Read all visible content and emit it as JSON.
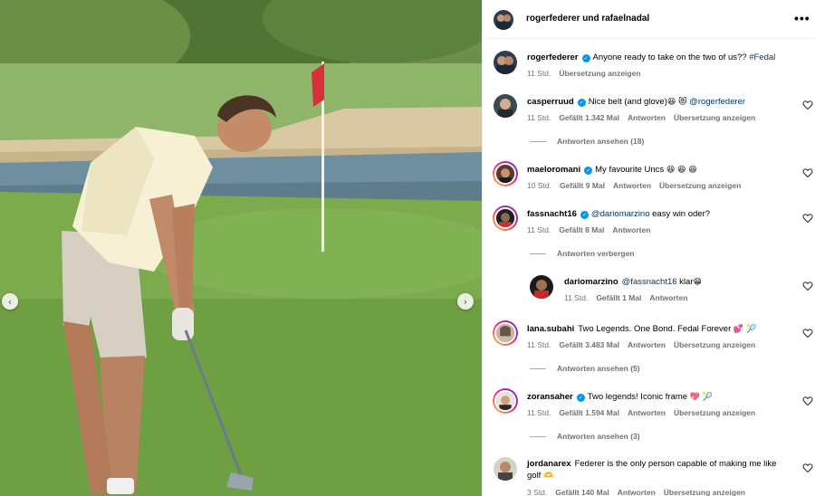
{
  "header": {
    "title": "rogerfederer und rafaelnadal",
    "more_icon": "more-horizontal-icon"
  },
  "photo": {
    "prev_icon": "‹",
    "next_icon": "›"
  },
  "caption": {
    "username": "rogerfederer",
    "text": "Anyone ready to take on the two of us??",
    "hashtag": "#Fedal",
    "time": "11 Std.",
    "translate": "Übersetzung anzeigen"
  },
  "comments": [
    {
      "username": "casperruud",
      "text": "Nice belt (and glove)",
      "emoji": "😆 😻",
      "mention": "@rogerfederer",
      "time": "11 Std.",
      "likes": "Gefällt 1.342 Mal",
      "reply": "Antworten",
      "translate": "Übersetzung anzeigen",
      "replies": "Antworten ansehen (18)"
    },
    {
      "username": "maeloromani",
      "text": "My favourite Uncs",
      "emoji": "😆 😆 😆",
      "time": "10 Std.",
      "likes": "Gefällt 9 Mal",
      "reply": "Antworten",
      "translate": "Übersetzung anzeigen"
    },
    {
      "username": "fassnacht16",
      "mention": "@dariomarzino",
      "text": "easy win oder?",
      "time": "11 Std.",
      "likes": "Gefällt 8 Mal",
      "reply": "Antworten",
      "replies": "Antworten verbergen"
    },
    {
      "username": "dariomarzino",
      "mention": "@fassnacht16",
      "text": "klar",
      "emoji": "😁",
      "time": "11 Std.",
      "likes": "Gefällt 1 Mal",
      "reply": "Antworten"
    },
    {
      "username": "lana.subahi",
      "text": "Two Legends. One Bond. Fedal Forever",
      "emoji": "💕 🎾",
      "time": "11 Std.",
      "likes": "Gefällt 3.483 Mal",
      "reply": "Antworten",
      "translate": "Übersetzung anzeigen",
      "replies": "Antworten ansehen (5)"
    },
    {
      "username": "zoransaher",
      "text": "Two legends! Iconic frame",
      "emoji": "💖 🎾",
      "time": "11 Std.",
      "likes": "Gefällt 1.594 Mal",
      "reply": "Antworten",
      "translate": "Übersetzung anzeigen",
      "replies": "Antworten ansehen (3)"
    },
    {
      "username": "jordanarex",
      "text": "Federer is the only person capable of making me like golf",
      "emoji": "🫶",
      "time": "3 Std.",
      "likes": "Gefällt 140 Mal",
      "reply": "Antworten",
      "translate": "Übersetzung anzeigen"
    }
  ],
  "colors": {
    "verified": "#0095f6",
    "link": "#00376b",
    "meta": "#737373"
  }
}
